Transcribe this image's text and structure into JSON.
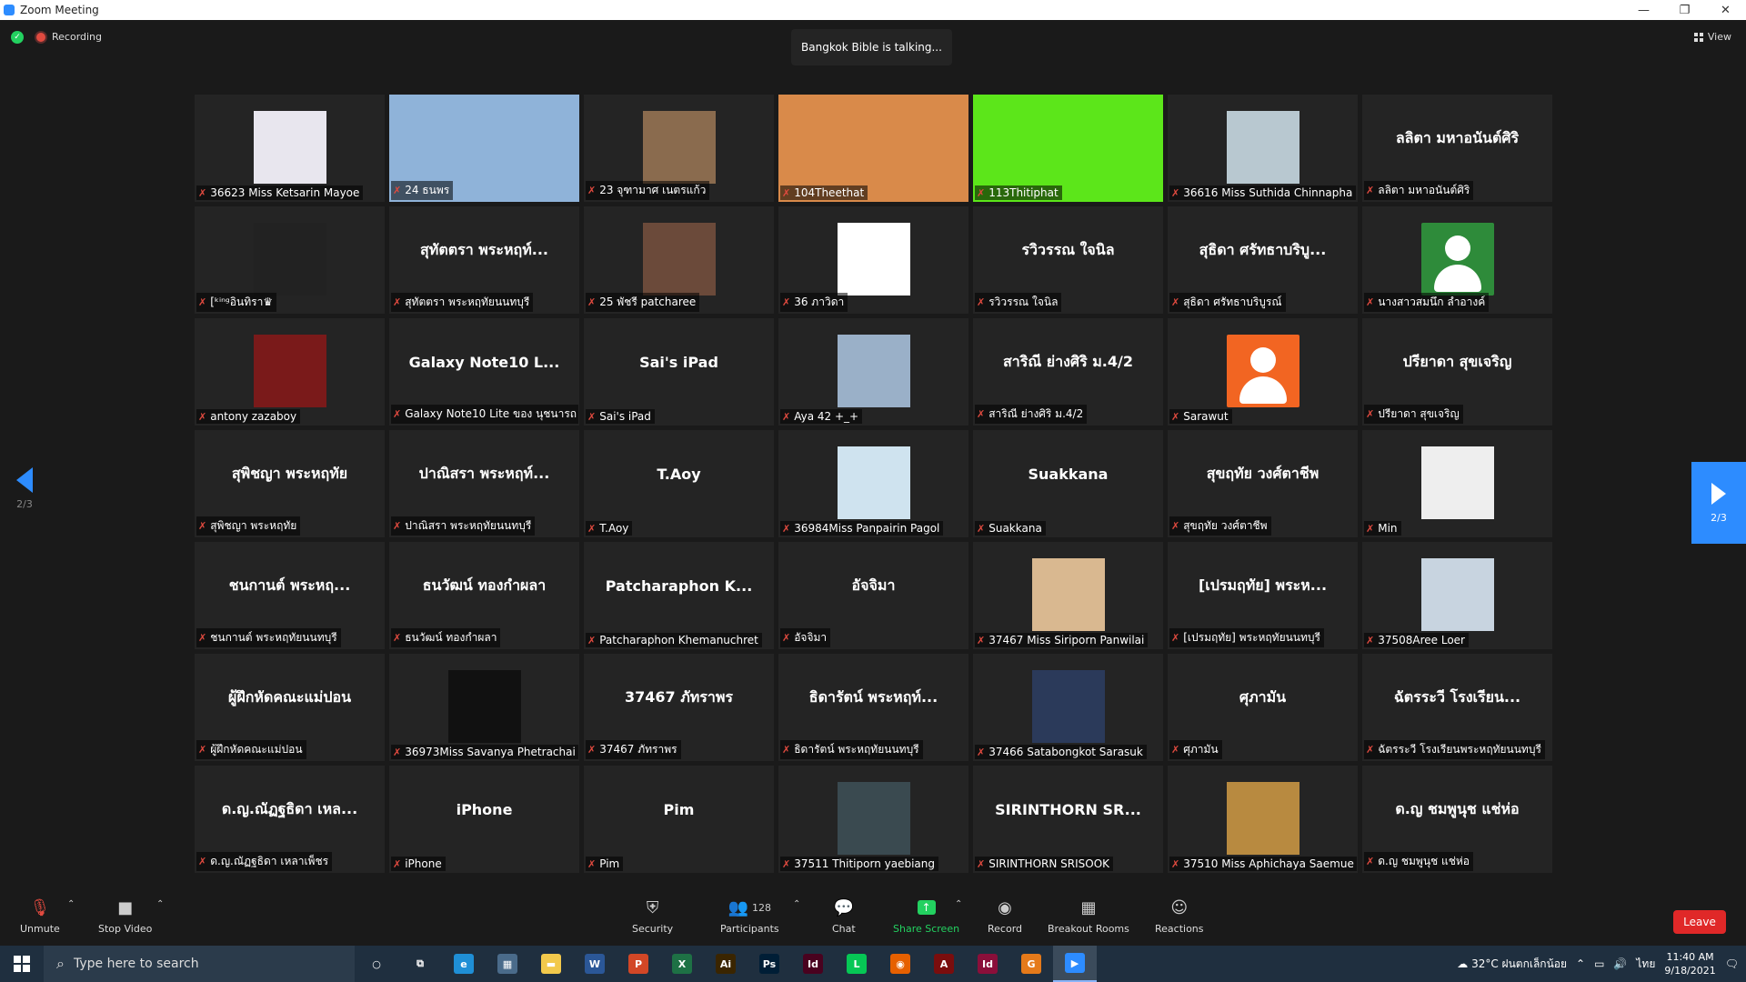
{
  "window": {
    "title": "Zoom Meeting",
    "controls": [
      "—",
      "❐",
      "✕"
    ]
  },
  "header": {
    "recording": "Recording",
    "talking": "Bangkok Bible is talking...",
    "view": "View"
  },
  "pagination": {
    "left": "2/3",
    "right": "2/3"
  },
  "tiles": [
    {
      "type": "photo",
      "label": "36623 Miss Ketsarin Mayoe",
      "color": "#e8e6ee"
    },
    {
      "type": "full",
      "label": "24 ธนพร",
      "color": "#8fb3d9"
    },
    {
      "type": "photo",
      "label": "23 จุฑามาศ เนตรแก้ว",
      "color": "#8a6b4e"
    },
    {
      "type": "full",
      "label": "104Theethat",
      "color": "#d98a4a"
    },
    {
      "type": "full",
      "label": "113Thitiphat",
      "color": "#5ce61a"
    },
    {
      "type": "photo",
      "label": "36616 Miss Suthida Chinnapha",
      "color": "#b8c8d0"
    },
    {
      "type": "name",
      "name": "ลลิตา มหาอนันต์ศิริ",
      "label": "ลลิตา มหาอนันต์ศิริ"
    },
    {
      "type": "photo",
      "label": "[ᵏⁱⁿᵍอินทิรา♛",
      "color": "#222222"
    },
    {
      "type": "name",
      "name": "สุทัตตรา พระหฤท์...",
      "label": "สุทัตตรา พระหฤทัยนนทบุรี"
    },
    {
      "type": "photo",
      "label": "25 พัชรี patcharee",
      "color": "#6b4a3a"
    },
    {
      "type": "photo",
      "label": "36 ภาวิดา",
      "color": "#ffffff"
    },
    {
      "type": "name",
      "name": "รวิวรรณ ใจนิล",
      "label": "รวิวรรณ ใจนิล"
    },
    {
      "type": "name",
      "name": "สุธิดา ศรัทธาบริบู...",
      "label": "สุธิดา ศรัทธาบริบูรณ์"
    },
    {
      "type": "avatar",
      "label": "นางสาวสมนึก ลำอางค์",
      "color": "#2e8b3a"
    },
    {
      "type": "photo",
      "label": "antony zazaboy",
      "color": "#7a1a1a"
    },
    {
      "type": "name",
      "name": "Galaxy Note10 L...",
      "label": "Galaxy Note10 Lite ของ นุชนารถ"
    },
    {
      "type": "name",
      "name": "Sai's iPad",
      "label": "Sai's iPad"
    },
    {
      "type": "photo",
      "label": "Aya 42 +_+",
      "color": "#9ab0c8"
    },
    {
      "type": "name",
      "name": "สาริณี ย่างศิริ ม.4/2",
      "label": "สาริณี ย่างศิริ ม.4/2"
    },
    {
      "type": "avatar",
      "label": "Sarawut",
      "color": "#f26522"
    },
    {
      "type": "name",
      "name": "ปรียาดา สุขเจริญ",
      "label": "ปรียาดา สุขเจริญ"
    },
    {
      "type": "name",
      "name": "สุพิชญา พระหฤทัย",
      "label": "สุพิชญา พระหฤทัย"
    },
    {
      "type": "name",
      "name": "ปาณิสรา พระหฤท์...",
      "label": "ปาณิสรา พระหฤทัยนนทบุรี"
    },
    {
      "type": "name",
      "name": "T.Aoy",
      "label": "T.Aoy"
    },
    {
      "type": "photo",
      "label": "36984Miss Panpairin Pagol",
      "color": "#cfe3ef"
    },
    {
      "type": "name",
      "name": "Suakkana",
      "label": "Suakkana"
    },
    {
      "type": "name",
      "name": "สุขฤทัย วงศ์ตาชีพ",
      "label": "สุขฤทัย วงศ์ตาชีพ"
    },
    {
      "type": "photo",
      "label": "Min",
      "color": "#eeeeee"
    },
    {
      "type": "name",
      "name": "ชนกานต์ พระหฤ...",
      "label": "ชนกานต์ พระหฤทัยนนทบุรี"
    },
    {
      "type": "name",
      "name": "ธนวัฒน์ ทองกำผลา",
      "label": "ธนวัฒน์ ทองกำผลา"
    },
    {
      "type": "name",
      "name": "Patcharaphon K...",
      "label": "Patcharaphon Khemanuchret"
    },
    {
      "type": "name",
      "name": "อัจจิมา",
      "label": "อัจจิมา"
    },
    {
      "type": "photo",
      "label": "37467 Miss Siriporn Panwilai",
      "color": "#d9b890"
    },
    {
      "type": "name",
      "name": "[เปรมฤทัย] พระห...",
      "label": "[เปรมฤทัย] พระหฤทัยนนทบุรี"
    },
    {
      "type": "photo",
      "label": "37508Aree Loer",
      "color": "#c8d4e0"
    },
    {
      "type": "name",
      "name": "ผู้ฝึกหัดคณะแม่ปอน",
      "label": "ผู้ฝึกหัดคณะแม่ปอน"
    },
    {
      "type": "photo",
      "label": "36973Miss Savanya Phetrachai",
      "color": "#111111"
    },
    {
      "type": "name",
      "name": "37467 ภัทราพร",
      "label": "37467 ภัทราพร"
    },
    {
      "type": "name",
      "name": "ธิดารัตน์ พระหฤท์...",
      "label": "ธิดารัตน์ พระหฤทัยนนทบุรี"
    },
    {
      "type": "photo",
      "label": "37466 Satabongkot Sarasuk",
      "color": "#2b3a5a"
    },
    {
      "type": "name",
      "name": "ศุภามัน",
      "label": "ศุภามัน"
    },
    {
      "type": "name",
      "name": "ฉัตรระวี โรงเรียน...",
      "label": "ฉัตรระวี โรงเรียนพระหฤทัยนนทบุรี"
    },
    {
      "type": "name",
      "name": "ด.ญ.ณัฏฐธิดา เหล...",
      "label": "ด.ญ.ณัฏฐธิดา เหลาเพ็ชร"
    },
    {
      "type": "name",
      "name": "iPhone",
      "label": "iPhone"
    },
    {
      "type": "name",
      "name": "Pim",
      "label": "Pim"
    },
    {
      "type": "photo",
      "label": "37511 Thitiporn yaebiang",
      "color": "#3a4a50"
    },
    {
      "type": "name",
      "name": "SIRINTHORN SR...",
      "label": "SIRINTHORN SRISOOK"
    },
    {
      "type": "photo",
      "label": "37510 Miss Aphichaya Saemue",
      "color": "#b88a40"
    },
    {
      "type": "name",
      "name": "ด.ญ ชมพูนุช แช่ห่อ",
      "label": "ด.ญ ชมพูนุช แช่ห่อ"
    }
  ],
  "toolbar": {
    "unmute": "Unmute",
    "stop_video": "Stop Video",
    "security": "Security",
    "participants": "Participants",
    "participants_count": "128",
    "chat": "Chat",
    "share_screen": "Share Screen",
    "record": "Record",
    "breakout": "Breakout Rooms",
    "reactions": "Reactions",
    "leave": "Leave"
  },
  "taskbar": {
    "search_placeholder": "Type here to search",
    "weather": "32°C ฝนตกเล็กน้อย",
    "lang": "ไทย",
    "time": "11:40 AM",
    "date": "9/18/2021",
    "apps": [
      {
        "icon": "cortana-icon",
        "glyph": "○",
        "color": "transparent"
      },
      {
        "icon": "task-view-icon",
        "glyph": "⧉",
        "color": "transparent"
      },
      {
        "icon": "edge-icon",
        "glyph": "e",
        "color": "#1f8fd6"
      },
      {
        "icon": "calculator-icon",
        "glyph": "▦",
        "color": "#4a6b8a"
      },
      {
        "icon": "file-explorer-icon",
        "glyph": "▬",
        "color": "#f2c94c"
      },
      {
        "icon": "word-icon",
        "glyph": "W",
        "color": "#2b5797"
      },
      {
        "icon": "powerpoint-icon",
        "glyph": "P",
        "color": "#d24726"
      },
      {
        "icon": "excel-icon",
        "glyph": "X",
        "color": "#1e7145"
      },
      {
        "icon": "illustrator-icon",
        "glyph": "Ai",
        "color": "#3a2500"
      },
      {
        "icon": "photoshop-icon",
        "glyph": "Ps",
        "color": "#001e36"
      },
      {
        "icon": "indesign-icon",
        "glyph": "Id",
        "color": "#49021f"
      },
      {
        "icon": "line-icon",
        "glyph": "L",
        "color": "#06c755"
      },
      {
        "icon": "firefox-icon",
        "glyph": "◉",
        "color": "#e66000"
      },
      {
        "icon": "acrobat-icon",
        "glyph": "A",
        "color": "#7a0d0d"
      },
      {
        "icon": "indesign-2-icon",
        "glyph": "Id",
        "color": "#8a0f3a"
      },
      {
        "icon": "grammarly-icon",
        "glyph": "G",
        "color": "#e57a1a"
      },
      {
        "icon": "zoom-icon",
        "glyph": "▶",
        "color": "#2d8cff"
      }
    ]
  }
}
